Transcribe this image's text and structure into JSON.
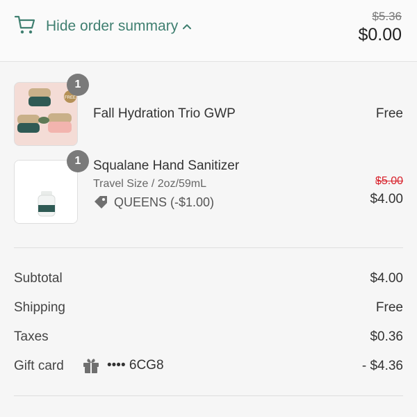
{
  "header": {
    "toggle_label": "Hide order summary",
    "original_total": "$5.36",
    "total": "$0.00",
    "accent_color": "#3f7f70"
  },
  "items": [
    {
      "quantity": "1",
      "name": "Fall Hydration Trio GWP",
      "price": "Free",
      "thumb_badge": "FREE"
    },
    {
      "quantity": "1",
      "name": "Squalane Hand Sanitizer",
      "variant": "Travel Size / 2oz/59mL",
      "discount_code": "QUEENS (-$1.00)",
      "original_price": "$5.00",
      "price": "$4.00"
    }
  ],
  "summary": {
    "subtotal_label": "Subtotal",
    "subtotal_value": "$4.00",
    "shipping_label": "Shipping",
    "shipping_value": "Free",
    "taxes_label": "Taxes",
    "taxes_value": "$0.36",
    "giftcard_label": "Gift card",
    "giftcard_code": "•••• 6CG8",
    "giftcard_value": "- $4.36"
  },
  "icons": {
    "cart": "cart-icon",
    "chevron": "chevron-up-icon",
    "tag": "tag-icon",
    "gift": "gift-icon"
  }
}
